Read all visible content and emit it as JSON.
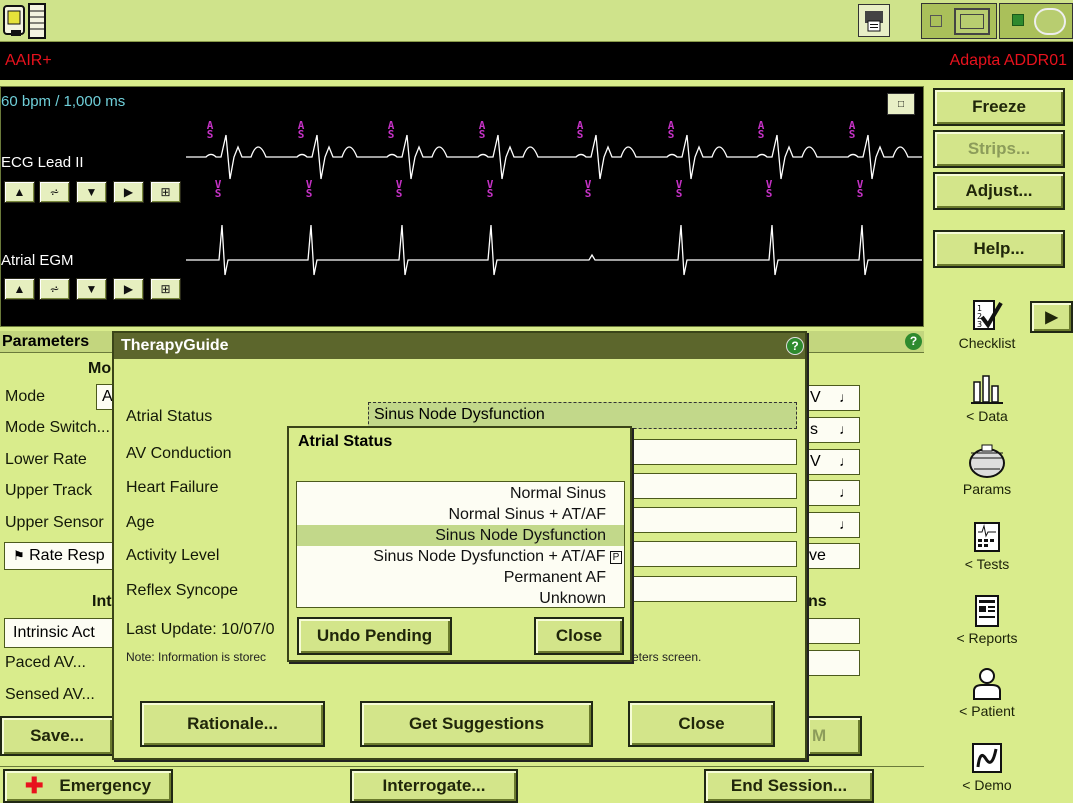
{
  "topbar": {
    "icons": [
      "programmer-icon",
      "printer-icon",
      "telemetry-icon",
      "wand-icon"
    ]
  },
  "header": {
    "mode": "AAIR+",
    "device": "Adapta ADDR01"
  },
  "ecg": {
    "rate_label": "60 bpm / 1,000 ms",
    "lead1": "ECG Lead II",
    "lead2": "Atrial EGM",
    "marker_as": "AS",
    "marker_vs": "VS"
  },
  "right_buttons": {
    "freeze": "Freeze",
    "strips": "Strips...",
    "adjust": "Adjust...",
    "help": "Help..."
  },
  "sidebar": [
    {
      "label": "Checklist",
      "icon": "checklist-icon"
    },
    {
      "label": "< Data",
      "icon": "data-icon"
    },
    {
      "label": "Params",
      "icon": "params-icon"
    },
    {
      "label": "< Tests",
      "icon": "tests-icon"
    },
    {
      "label": "< Reports",
      "icon": "reports-icon"
    },
    {
      "label": "< Patient",
      "icon": "patient-icon"
    },
    {
      "label": "< Demo",
      "icon": "demo-icon"
    }
  ],
  "params_panel": {
    "title": "Parameters",
    "mode_heading": "Mo",
    "rows": [
      "Mode",
      "Mode Switch...",
      "Lower Rate",
      "Upper Track",
      "Upper Sensor"
    ],
    "mode_value_stub": "A",
    "rate_resp": "Rate Resp",
    "intrinsic_heading": "Int",
    "intrinsic_btn": "Intrinsic Act",
    "paced_av": "Paced AV...",
    "sensed_av": "Sensed AV...",
    "save": "Save...",
    "right_values": [
      "V",
      "s",
      "V",
      "",
      ""
    ],
    "right_save": "ve",
    "right_heading": "ns",
    "right_button_stub": "M"
  },
  "therapy_guide": {
    "title": "TherapyGuide",
    "labels": [
      "Atrial Status",
      "AV Conduction",
      "Heart Failure",
      "Age",
      "Activity Level",
      "Reflex Syncope"
    ],
    "atrial_value": "Sinus Node Dysfunction",
    "last_update": "Last Update: 10/07/0",
    "note_left": "Note: Information is storec",
    "note_right": "eters screen.",
    "rationale": "Rationale...",
    "get_suggestions": "Get Suggestions",
    "close": "Close"
  },
  "atrial_popup": {
    "title": "Atrial Status",
    "options": [
      "Normal Sinus",
      "Normal Sinus + AT/AF",
      "Sinus Node Dysfunction",
      "Sinus Node Dysfunction + AT/AF",
      "Permanent AF",
      "Unknown"
    ],
    "selected_index": 2,
    "pending_mark": "P",
    "undo": "Undo Pending",
    "close": "Close"
  },
  "bottom_bar": {
    "emergency": "Emergency",
    "interrogate": "Interrogate...",
    "end_session": "End Session..."
  },
  "colors": {
    "panel": "#d9ec8c",
    "header_bg": "#000000",
    "header_text": "#e8121d",
    "ecg_bg": "#000000",
    "ecg_label": "#6fcfd9",
    "marker": "#c632c6",
    "dialog_title": "#5c662c",
    "help_badge": "#2e8a2e"
  }
}
